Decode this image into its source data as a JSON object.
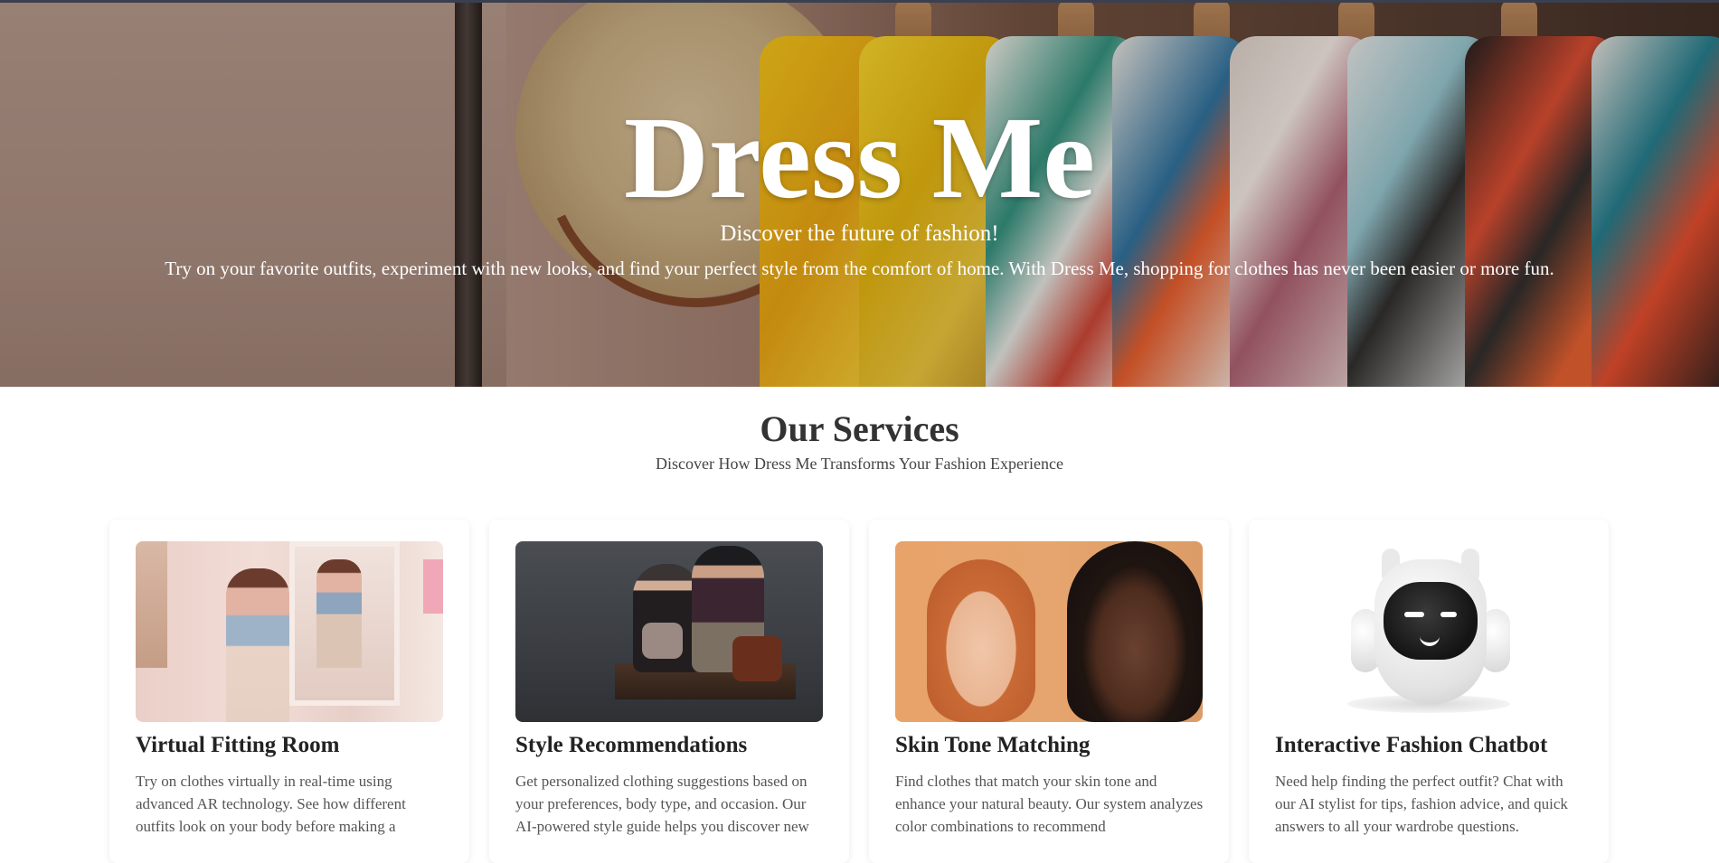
{
  "hero": {
    "title": "Dress Me",
    "subtitle": "Discover the future of fashion!",
    "description": "Try on your favorite outfits, experiment with new looks, and find your perfect style from the comfort of home. With Dress Me, shopping for clothes has never been easier or more fun."
  },
  "services": {
    "title": "Our Services",
    "subtitle": "Discover How Dress Me Transforms Your Fashion Experience",
    "cards": [
      {
        "title": "Virtual Fitting Room",
        "text": "Try on clothes virtually in real-time using advanced AR technology. See how different outfits look on your body before making a"
      },
      {
        "title": "Style Recommendations",
        "text": "Get personalized clothing suggestions based on your preferences, body type, and occasion. Our AI-powered style guide helps you discover new"
      },
      {
        "title": "Skin Tone Matching",
        "text": "Find clothes that match your skin tone and enhance your natural beauty. Our system analyzes color combinations to recommend"
      },
      {
        "title": "Interactive Fashion Chatbot",
        "text": "Need help finding the perfect outfit? Chat with our AI stylist for tips, fashion advice, and quick answers to all your wardrobe questions."
      }
    ]
  },
  "colors": {
    "text_dark": "#333333",
    "hero_text": "#ffffff",
    "card_bg": "#ffffff"
  }
}
